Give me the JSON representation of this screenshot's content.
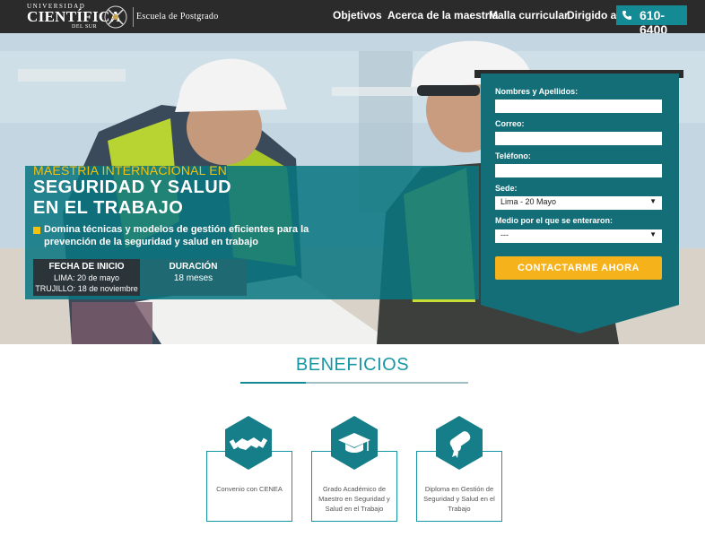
{
  "header": {
    "logo": {
      "line1": "UNIVERSIDAD",
      "line2": "CIENTÍFICA",
      "line3": "DEL SUR",
      "school": "Escuela de Postgrado"
    },
    "nav": [
      "Objetivos",
      "Acerca de la maestría",
      "Malla curricular",
      "Dirigido a"
    ],
    "phone": "610-6400"
  },
  "hero": {
    "subtitle": "MAESTRIA INTERNACIONAL EN",
    "title_line1": "SEGURIDAD Y SALUD",
    "title_line2": "EN EL TRABAJO",
    "description_line1": "Domina técnicas y modelos de gestión eficientes para la",
    "description_line2": "prevención de la seguridad y salud en trabajo",
    "fecha": {
      "title": "FECHA DE INICIO",
      "line1": "LIMA: 20 de mayo",
      "line2": "TRUJILLO: 18 de noviembre"
    },
    "duracion": {
      "title": "DURACIÓN",
      "value": "18 meses"
    }
  },
  "form": {
    "name_label": "Nombres y Apellidos:",
    "email_label": "Correo:",
    "phone_label": "Teléfono:",
    "sede_label": "Sede:",
    "sede_value": "Lima - 20 Mayo",
    "medio_label": "Medio por el que se enteraron:",
    "medio_value": "---",
    "submit": "CONTACTARME AHORA"
  },
  "beneficios": {
    "title": "BENEFICIOS",
    "items": [
      {
        "icon": "handshake-icon",
        "text_lines": [
          "Convenio con CENEA"
        ]
      },
      {
        "icon": "graduation-cap-icon",
        "text_lines": [
          "Grado Académico de",
          "Maestro en Seguridad y",
          "Salud en el Trabajo"
        ]
      },
      {
        "icon": "diploma-icon",
        "text_lines": [
          "Diploma en Gestión de",
          "Seguridad y Salud en el",
          "Trabajo"
        ]
      }
    ]
  },
  "colors": {
    "header_bg": "#2b2b2b",
    "teal": "#138a94",
    "teal_dark": "#136e77",
    "accent_yellow": "#f4c20d",
    "cta_orange": "#f6b21b"
  }
}
